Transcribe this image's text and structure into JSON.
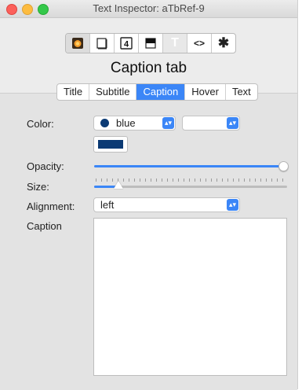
{
  "window": {
    "title": "Text Inspector: aTbRef-9"
  },
  "toolbar": {
    "buttons": [
      {
        "name": "general-icon"
      },
      {
        "name": "appearance-icon"
      },
      {
        "name": "quickstamp-icon"
      },
      {
        "name": "properties-icon"
      },
      {
        "name": "text-icon",
        "glyph": "T"
      },
      {
        "name": "code-icon",
        "glyph": "<>"
      },
      {
        "name": "gear-icon",
        "glyph": "✱"
      }
    ]
  },
  "heading": "Caption tab",
  "tabs": [
    "Title",
    "Subtitle",
    "Caption",
    "Hover",
    "Text"
  ],
  "active_tab": "Caption",
  "fields": {
    "color_label": "Color:",
    "color_value": "blue",
    "color_swatch_hex": "#0b3a74",
    "opacity_label": "Opacity:",
    "opacity_value": 1.0,
    "size_label": "Size:",
    "alignment_label": "Alignment:",
    "alignment_value": "left",
    "caption_label": "Caption",
    "caption_text": ""
  },
  "colors": {
    "accent": "#3b86f7"
  }
}
